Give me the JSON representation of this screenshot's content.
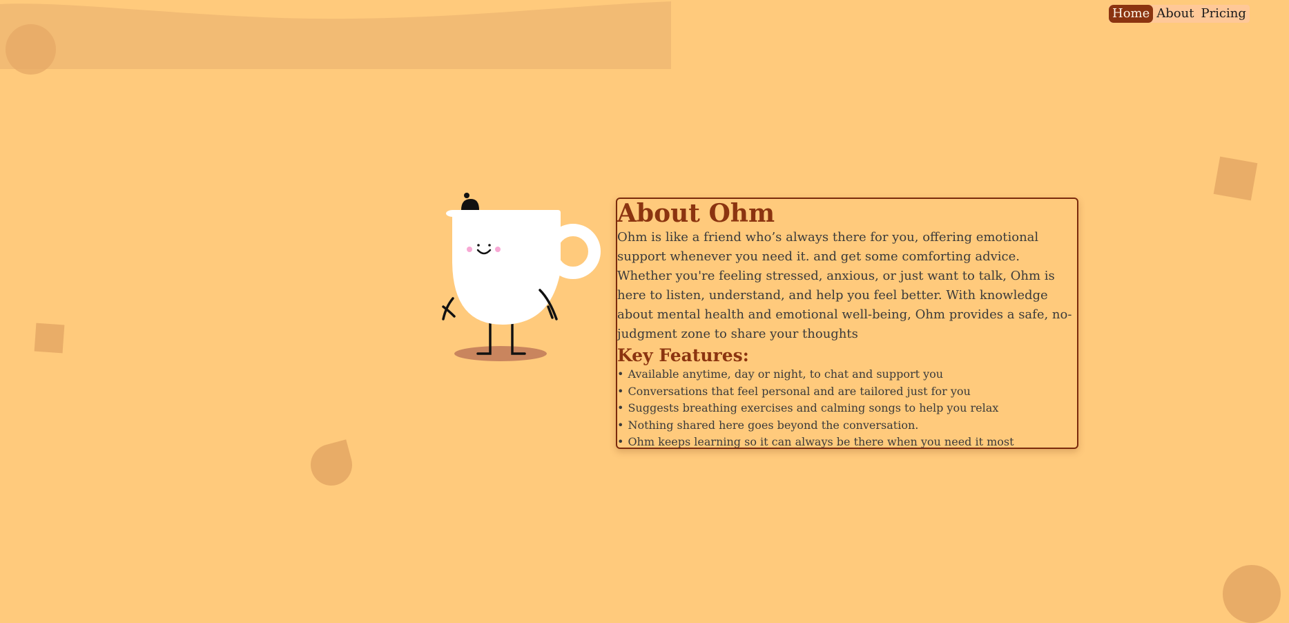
{
  "nav": {
    "items": [
      {
        "label": "Home",
        "active": true
      },
      {
        "label": "About",
        "active": false
      },
      {
        "label": "Pricing",
        "active": false
      }
    ]
  },
  "about": {
    "title": "About Ohm",
    "description": "Ohm is like a friend who’s always there for you, offering emotional support whenever you need it. and get some comforting advice. Whether you're feeling stressed, anxious, or just want to talk, Ohm is here to listen, understand, and help you feel better. With knowledge about mental health and emotional well-being, Ohm provides a safe, no-judgment zone to share your thoughts",
    "features_heading": "Key Features:",
    "bullet": "•",
    "features": [
      "Available anytime, day or night, to chat and support you",
      "Conversations that feel personal and are tailored just for you",
      "Suggests breathing exercises and calming songs to help you relax",
      "Nothing shared here goes beyond the conversation.",
      "Ohm keeps learning so it can always be there when you need it most"
    ]
  },
  "colors": {
    "background": "#ffca7c",
    "accent": "#8b3410",
    "text": "#3a3a3a",
    "decor": "#e5a865"
  },
  "icons": [
    "coffee-cup-mascot"
  ]
}
